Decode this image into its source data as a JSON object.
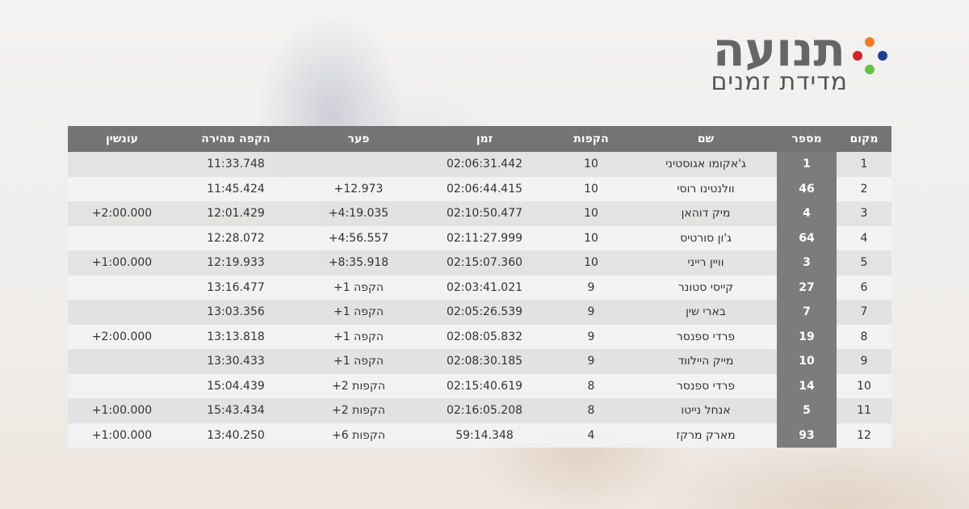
{
  "brand": {
    "title": "תנועה",
    "subtitle": "מדידת זמנים",
    "dot_colors": [
      "#f07b26",
      "#d0242b",
      "#1f3f96",
      "#68c044"
    ]
  },
  "results": {
    "columns": [
      "מקום",
      "מספר",
      "שם",
      "הקפות",
      "זמן",
      "פער",
      "הקפה מהירה",
      "עונשין"
    ],
    "rows": [
      {
        "place": "1",
        "number": "1",
        "name": "ג'אקומו אגוסטיני",
        "laps": "10",
        "time": "02:06:31.442",
        "gap": "",
        "fastest_lap": "11:33.748",
        "penalty": ""
      },
      {
        "place": "2",
        "number": "46",
        "name": "וולנטינו רוסי",
        "laps": "10",
        "time": "02:06:44.415",
        "gap": "+12.973",
        "fastest_lap": "11:45.424",
        "penalty": ""
      },
      {
        "place": "3",
        "number": "4",
        "name": "מיק דוהאן",
        "laps": "10",
        "time": "02:10:50.477",
        "gap": "+4:19.035",
        "fastest_lap": "12:01.429",
        "penalty": "+2:00.000"
      },
      {
        "place": "4",
        "number": "64",
        "name": "ג'ון סורטיס",
        "laps": "10",
        "time": "02:11:27.999",
        "gap": "+4:56.557",
        "fastest_lap": "12:28.072",
        "penalty": ""
      },
      {
        "place": "5",
        "number": "3",
        "name": "וויין רייני",
        "laps": "10",
        "time": "02:15:07.360",
        "gap": "+8:35.918",
        "fastest_lap": "12:19.933",
        "penalty": "+1:00.000"
      },
      {
        "place": "6",
        "number": "27",
        "name": "קייסי סטונר",
        "laps": "9",
        "time": "02:03:41.021",
        "gap": "+1 הקפה",
        "fastest_lap": "13:16.477",
        "penalty": ""
      },
      {
        "place": "7",
        "number": "7",
        "name": "בארי שין",
        "laps": "9",
        "time": "02:05:26.539",
        "gap": "+1 הקפה",
        "fastest_lap": "13:03.356",
        "penalty": ""
      },
      {
        "place": "8",
        "number": "19",
        "name": "פרדי ספנסר",
        "laps": "9",
        "time": "02:08:05.832",
        "gap": "+1 הקפה",
        "fastest_lap": "13:13.818",
        "penalty": "+2:00.000"
      },
      {
        "place": "9",
        "number": "10",
        "name": "מייק היילווד",
        "laps": "9",
        "time": "02:08:30.185",
        "gap": "+1 הקפה",
        "fastest_lap": "13:30.433",
        "penalty": ""
      },
      {
        "place": "10",
        "number": "14",
        "name": "פרדי ספנסר",
        "laps": "8",
        "time": "02:15:40.619",
        "gap": "+2 הקפות",
        "fastest_lap": "15:04.439",
        "penalty": ""
      },
      {
        "place": "11",
        "number": "5",
        "name": "אנחל נייטו",
        "laps": "8",
        "time": "02:16:05.208",
        "gap": "+2 הקפות",
        "fastest_lap": "15:43.434",
        "penalty": "+1:00.000"
      },
      {
        "place": "12",
        "number": "93",
        "name": "מארק מרקז",
        "laps": "4",
        "time": "59:14.348",
        "gap": "+6 הקפות",
        "fastest_lap": "13:40.250",
        "penalty": "+1:00.000"
      }
    ]
  }
}
